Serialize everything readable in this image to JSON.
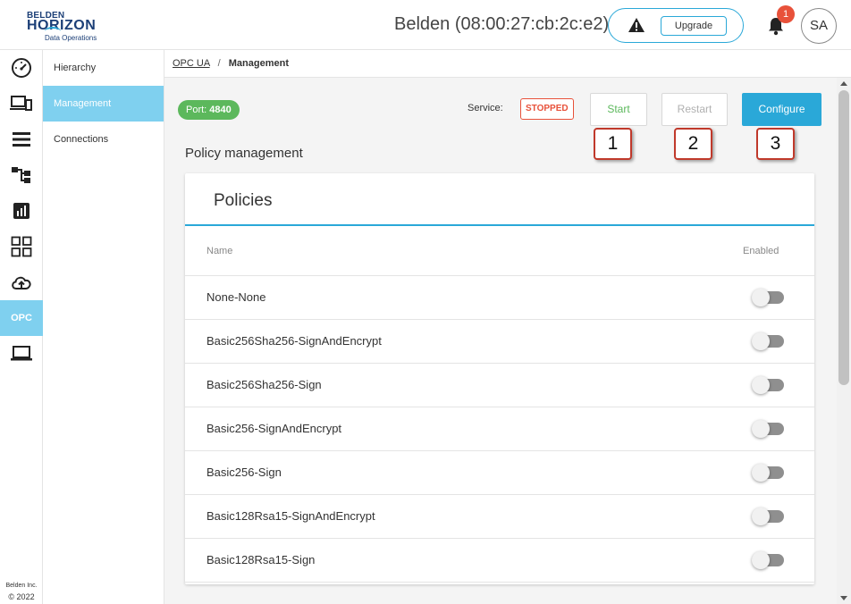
{
  "header": {
    "logo": {
      "line1": "BELDEN",
      "line2": "HORIZON",
      "line3": "Data Operations"
    },
    "device_title": "Belden (08:00:27:cb:2c:e2)",
    "upgrade_label": "Upgrade",
    "notification_count": "1",
    "avatar_initials": "SA"
  },
  "rail": {
    "items": [
      {
        "icon": "dashboard-gauge-icon"
      },
      {
        "icon": "devices-icon"
      },
      {
        "icon": "list-icon"
      },
      {
        "icon": "hierarchy-icon"
      },
      {
        "icon": "analytics-icon"
      },
      {
        "icon": "apps-grid-icon"
      },
      {
        "icon": "cloud-upload-icon"
      },
      {
        "label": "OPC"
      },
      {
        "icon": "laptop-icon"
      }
    ],
    "footer_company": "Belden Inc.",
    "footer_year": "© 2022"
  },
  "subnav": {
    "items": [
      "Hierarchy",
      "Management",
      "Connections"
    ],
    "active": "Management"
  },
  "breadcrumb": {
    "link": "OPC UA",
    "separator": "/",
    "current": "Management"
  },
  "service": {
    "port_label": "Port:",
    "port_value": "4840",
    "service_label": "Service:",
    "status": "STOPPED",
    "start_label": "Start",
    "restart_label": "Restart",
    "configure_label": "Configure"
  },
  "callouts": [
    "1",
    "2",
    "3"
  ],
  "section_title": "Policy management",
  "policies": {
    "title": "Policies",
    "col_name": "Name",
    "col_enabled": "Enabled",
    "rows": [
      {
        "name": "None-None",
        "enabled": false
      },
      {
        "name": "Basic256Sha256-SignAndEncrypt",
        "enabled": false
      },
      {
        "name": "Basic256Sha256-Sign",
        "enabled": false
      },
      {
        "name": "Basic256-SignAndEncrypt",
        "enabled": false
      },
      {
        "name": "Basic256-Sign",
        "enabled": false
      },
      {
        "name": "Basic128Rsa15-SignAndEncrypt",
        "enabled": false
      },
      {
        "name": "Basic128Rsa15-Sign",
        "enabled": false
      }
    ]
  },
  "colors": {
    "accent": "#2aa8d8",
    "active_nav": "#7fd0ef",
    "success": "#5cb85c",
    "danger": "#e8513a"
  }
}
